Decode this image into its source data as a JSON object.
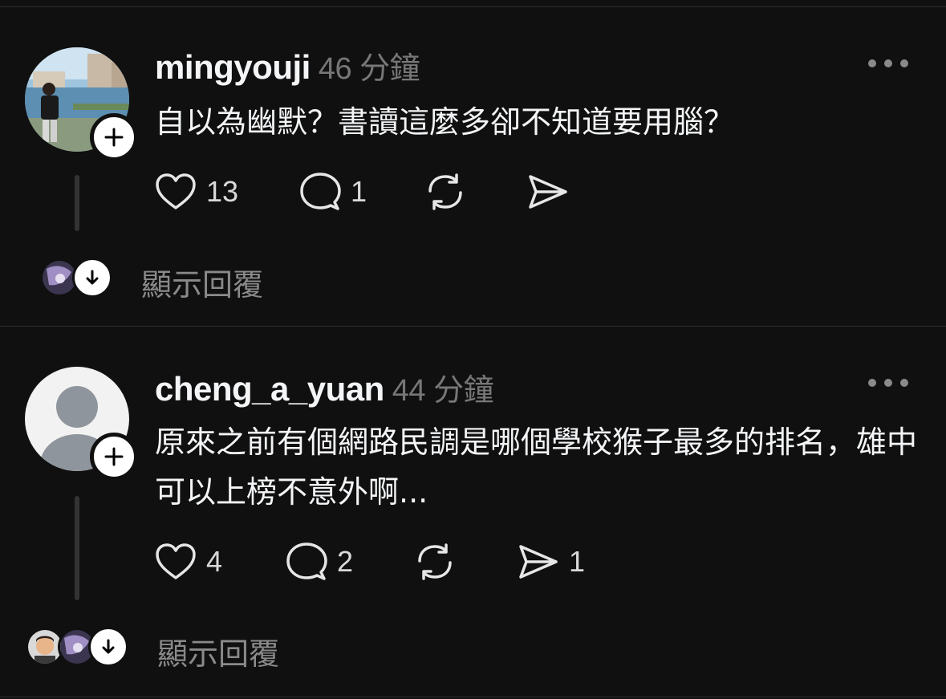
{
  "posts": [
    {
      "username": "mingyouji",
      "time": "46 分鐘",
      "text": "自以為幽默？書讀這麼多卻不知道要用腦？",
      "likes": "13",
      "comments": "1",
      "shares": "",
      "show_replies": "顯示回覆"
    },
    {
      "username": "cheng_a_yuan",
      "time": "44 分鐘",
      "text": "原來之前有個網路民調是哪個學校猴子最多的排名，雄中可以上榜不意外啊...",
      "likes": "4",
      "comments": "2",
      "shares": "1",
      "show_replies": "顯示回覆"
    }
  ],
  "icons": {
    "like": "heart-icon",
    "comment": "speech-bubble-icon",
    "repost": "repost-icon",
    "share": "send-icon",
    "follow": "plus-icon",
    "expand": "arrow-down-icon",
    "more": "more-horizontal-icon"
  },
  "colors": {
    "background": "#101010",
    "text": "#f3f5f7",
    "secondary": "#777777",
    "divider": "#2e2e2e"
  }
}
